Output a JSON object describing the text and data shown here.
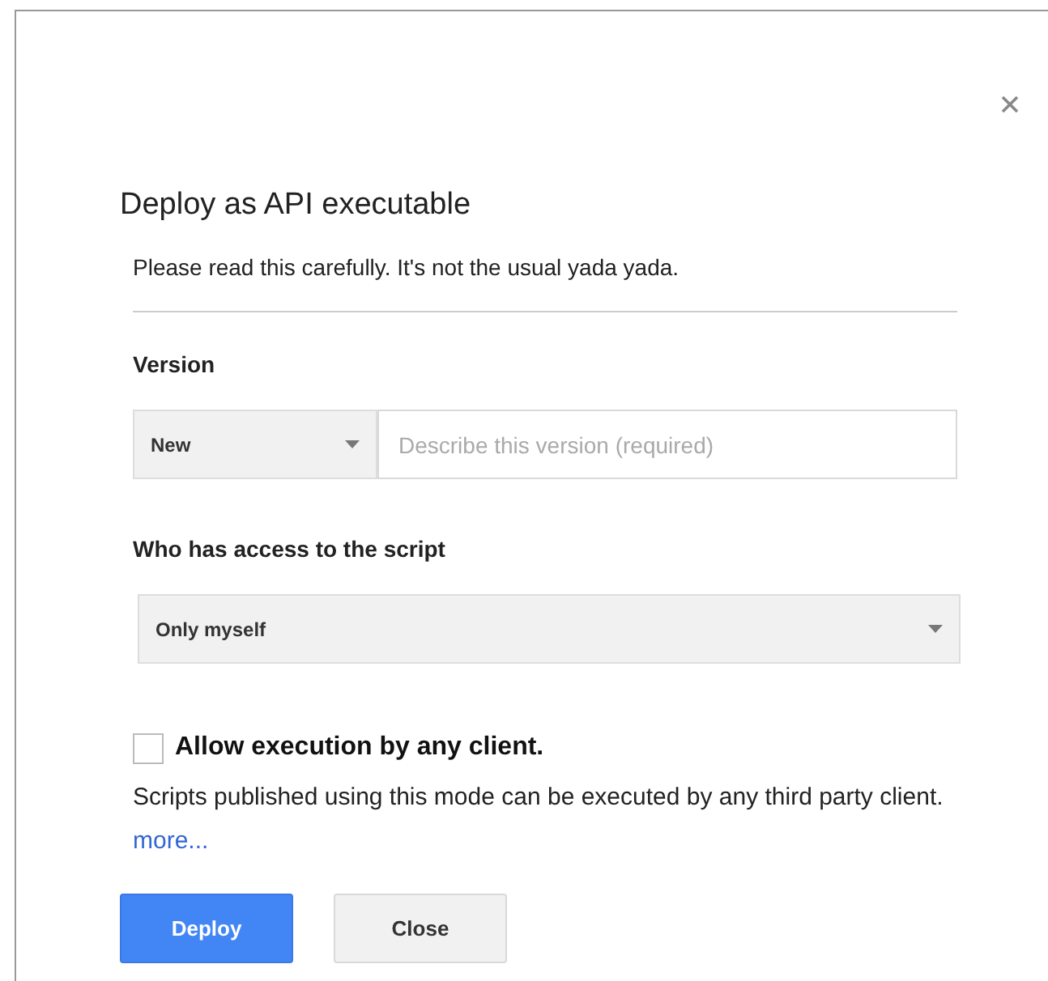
{
  "dialog": {
    "title": "Deploy as API executable",
    "intro": "Please read this carefully. It's not the usual yada yada.",
    "version": {
      "label": "Version",
      "select_value": "New",
      "placeholder": "Describe this version (required)"
    },
    "access": {
      "label": "Who has access to the script",
      "select_value": "Only myself"
    },
    "allow_any_client": {
      "label": "Allow execution by any client.",
      "checked": false,
      "description": "Scripts published using this mode can be executed by any third party client.",
      "link": "more..."
    },
    "buttons": [
      {
        "label": "Deploy",
        "kind": "primary"
      },
      {
        "label": "Close",
        "kind": "secondary"
      }
    ]
  }
}
